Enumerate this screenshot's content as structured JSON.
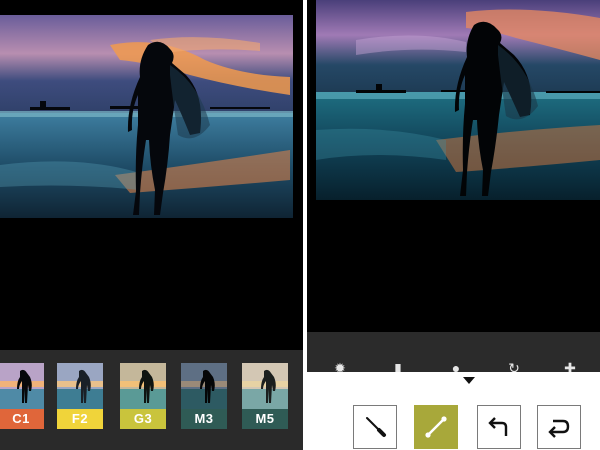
{
  "filters": [
    {
      "label": "C1",
      "color": "#e0663a"
    },
    {
      "label": "F2",
      "color": "#f0d43a"
    },
    {
      "label": "G3",
      "color": "#c9c43c"
    },
    {
      "label": "M3",
      "color": "#2f5b55"
    },
    {
      "label": "M5",
      "color": "#2f5b55"
    }
  ],
  "tools": [
    {
      "name": "brush",
      "active": false
    },
    {
      "name": "bone-brush",
      "active": true
    },
    {
      "name": "undo",
      "active": false
    },
    {
      "name": "redo",
      "active": false
    }
  ],
  "colors": {
    "active_tool": "#a8a83a",
    "panel_bg": "#000000",
    "strip_bg": "#2a2a2a"
  }
}
